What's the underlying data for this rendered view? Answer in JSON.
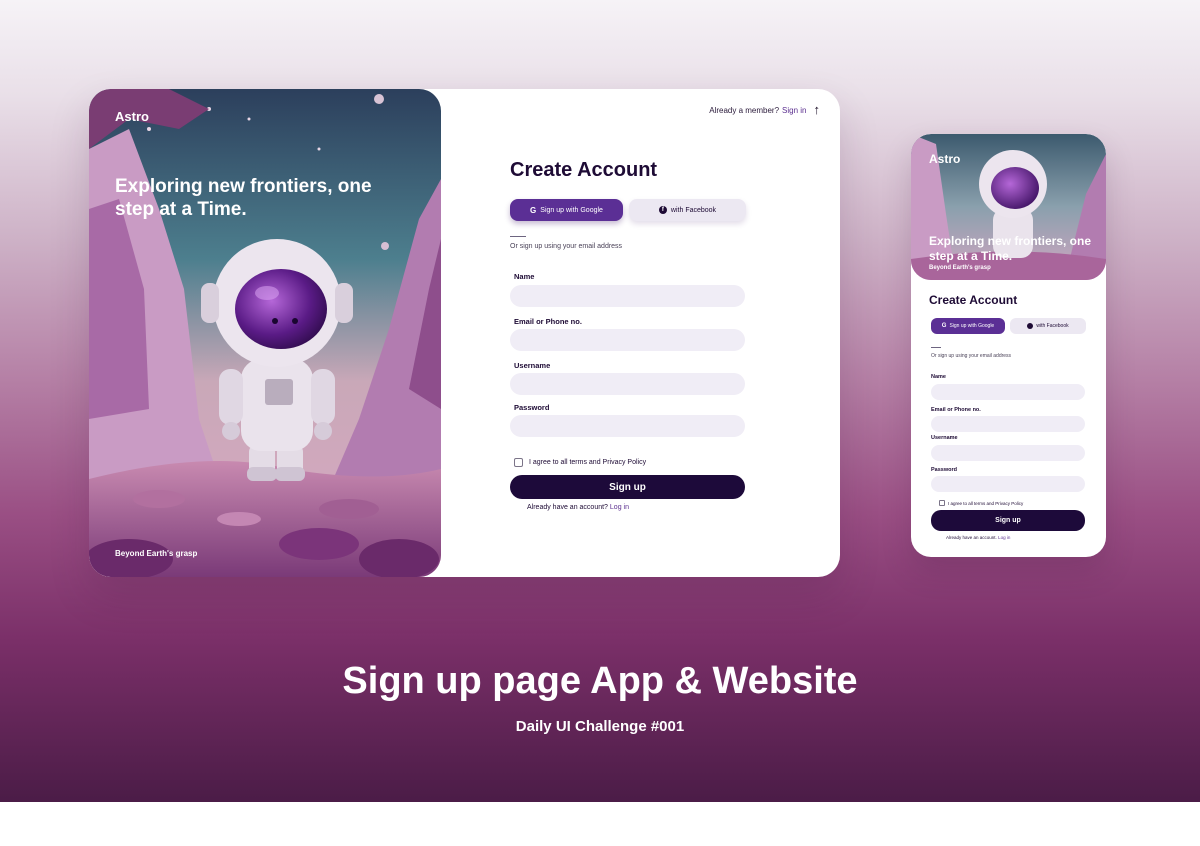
{
  "desktop": {
    "brand": "Astro",
    "headline": "Exploring new frontiers, one step at a Time.",
    "tagline": "Beyond Earth's grasp",
    "top_link": {
      "text": "Already a member?",
      "link": "Sign in"
    },
    "title": "Create Account",
    "google_button": "Sign up with Google",
    "facebook_button": "with Facebook",
    "or_text": "Or sign up using your email address",
    "fields": {
      "name": {
        "label": "Name",
        "value": ""
      },
      "email": {
        "label": "Email or Phone no.",
        "value": ""
      },
      "username": {
        "label": "Username",
        "value": ""
      },
      "password": {
        "label": "Password",
        "value": ""
      }
    },
    "agree_text": "I agree to all terms and Privacy Policy",
    "signup_button": "Sign up",
    "already": {
      "text": "Already have an account?",
      "link": "Log in"
    }
  },
  "mobile": {
    "brand": "Astro",
    "headline": "Exploring new frontiers, one step at a Time.",
    "tagline": "Beyond Earth's grasp",
    "title": "Create Account",
    "google_button": "Sign up with Google",
    "facebook_button": "with Facebook",
    "or_text": "Or sign up using your email address",
    "fields": {
      "name": "Name",
      "email": "Email or Phone no.",
      "username": "Username",
      "password": "Password"
    },
    "agree_text": "I agree to all terms and Privacy Policy",
    "signup_button": "Sign up",
    "already": {
      "text": "Already have an account.",
      "link": "Log in"
    }
  },
  "caption": {
    "title": "Sign up page App & Website",
    "subtitle": "Daily UI Challenge #001"
  },
  "colors": {
    "primary_dark": "#1d0a3a",
    "primary_purple": "#5b2f95",
    "input_bg": "#f0edf6",
    "link": "#5b2f8f"
  },
  "icons": [
    "google-icon",
    "facebook-icon",
    "arrow-up-icon",
    "astronaut-illustration"
  ]
}
